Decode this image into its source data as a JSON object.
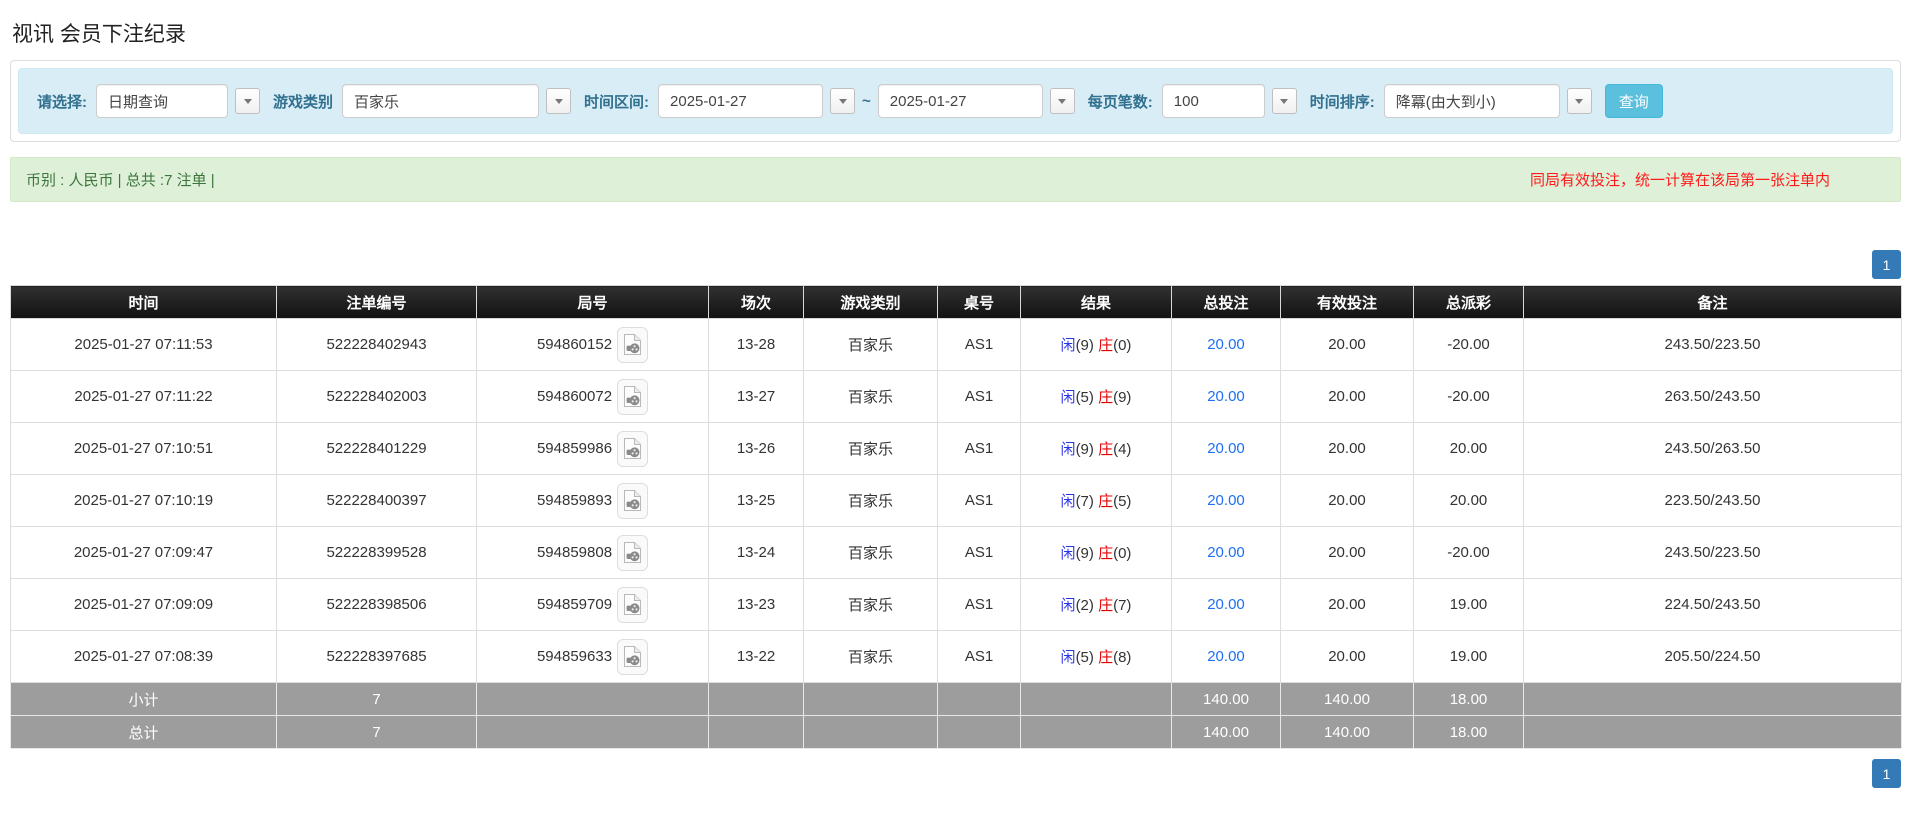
{
  "title": "视讯 会员下注纪录",
  "filters": {
    "query_type": {
      "label": "请选择:",
      "value": "日期查询"
    },
    "game_category": {
      "label": "游戏类别",
      "value": "百家乐"
    },
    "time_range": {
      "label": "时间区间:",
      "from": "2025-01-27",
      "separator": "~",
      "to": "2025-01-27"
    },
    "page_size": {
      "label": "每页笔数:",
      "value": "100"
    },
    "time_sort": {
      "label": "时间排序:",
      "value": "降冪(由大到小)"
    },
    "search_button": "查询"
  },
  "summary": {
    "left": "币别 : 人民币 | 总共 :7 注单 |",
    "notice": "同局有效投注，统一计算在该局第一张注单内"
  },
  "pagination": {
    "page": "1"
  },
  "icons": {
    "dropdown": "chevron-down-icon",
    "round_action": "video-file-icon"
  },
  "colors": {
    "filter_bar_bg": "#d9edf7",
    "filter_label": "#31708f",
    "search_button_bg": "#5bc0de",
    "summary_bg": "#dff0d8",
    "summary_text": "#3c763d",
    "notice_red": "#ff1a1a",
    "header_bg": "#1a1a1a",
    "sum_row_bg": "#9d9d9d",
    "pagination_active": "#337ab7",
    "bet_link": "#1f6ff0",
    "player_blue": "#2b35e8",
    "banker_red": "#e60000",
    "negative_red": "#ff0000"
  },
  "table": {
    "columns": [
      {
        "key": "time",
        "label": "时间"
      },
      {
        "key": "bet_no",
        "label": "注单编号"
      },
      {
        "key": "round_no",
        "label": "局号"
      },
      {
        "key": "session",
        "label": "场次"
      },
      {
        "key": "game",
        "label": "游戏类别"
      },
      {
        "key": "table_no",
        "label": "桌号"
      },
      {
        "key": "result",
        "label": "结果"
      },
      {
        "key": "total_bet",
        "label": "总投注"
      },
      {
        "key": "valid_bet",
        "label": "有效投注"
      },
      {
        "key": "payout",
        "label": "总派彩"
      },
      {
        "key": "remark",
        "label": "备注"
      }
    ],
    "rows": [
      {
        "time": "2025-01-27 07:11:53",
        "bet_no": "522228402943",
        "round_no": "594860152",
        "session": "13-28",
        "game": "百家乐",
        "table_no": "AS1",
        "player": "闲",
        "player_score": "(9)",
        "banker": "庄",
        "banker_score": "(0)",
        "total_bet": "20.00",
        "valid_bet": "20.00",
        "payout": "-20.00",
        "remark": "243.50/223.50"
      },
      {
        "time": "2025-01-27 07:11:22",
        "bet_no": "522228402003",
        "round_no": "594860072",
        "session": "13-27",
        "game": "百家乐",
        "table_no": "AS1",
        "player": "闲",
        "player_score": "(5)",
        "banker": "庄",
        "banker_score": "(9)",
        "total_bet": "20.00",
        "valid_bet": "20.00",
        "payout": "-20.00",
        "remark": "263.50/243.50"
      },
      {
        "time": "2025-01-27 07:10:51",
        "bet_no": "522228401229",
        "round_no": "594859986",
        "session": "13-26",
        "game": "百家乐",
        "table_no": "AS1",
        "player": "闲",
        "player_score": "(9)",
        "banker": "庄",
        "banker_score": "(4)",
        "total_bet": "20.00",
        "valid_bet": "20.00",
        "payout": "20.00",
        "remark": "243.50/263.50"
      },
      {
        "time": "2025-01-27 07:10:19",
        "bet_no": "522228400397",
        "round_no": "594859893",
        "session": "13-25",
        "game": "百家乐",
        "table_no": "AS1",
        "player": "闲",
        "player_score": "(7)",
        "banker": "庄",
        "banker_score": "(5)",
        "total_bet": "20.00",
        "valid_bet": "20.00",
        "payout": "20.00",
        "remark": "223.50/243.50"
      },
      {
        "time": "2025-01-27 07:09:47",
        "bet_no": "522228399528",
        "round_no": "594859808",
        "session": "13-24",
        "game": "百家乐",
        "table_no": "AS1",
        "player": "闲",
        "player_score": "(9)",
        "banker": "庄",
        "banker_score": "(0)",
        "total_bet": "20.00",
        "valid_bet": "20.00",
        "payout": "-20.00",
        "remark": "243.50/223.50"
      },
      {
        "time": "2025-01-27 07:09:09",
        "bet_no": "522228398506",
        "round_no": "594859709",
        "session": "13-23",
        "game": "百家乐",
        "table_no": "AS1",
        "player": "闲",
        "player_score": "(2)",
        "banker": "庄",
        "banker_score": "(7)",
        "total_bet": "20.00",
        "valid_bet": "20.00",
        "payout": "19.00",
        "remark": "224.50/243.50"
      },
      {
        "time": "2025-01-27 07:08:39",
        "bet_no": "522228397685",
        "round_no": "594859633",
        "session": "13-22",
        "game": "百家乐",
        "table_no": "AS1",
        "player": "闲",
        "player_score": "(5)",
        "banker": "庄",
        "banker_score": "(8)",
        "total_bet": "20.00",
        "valid_bet": "20.00",
        "payout": "19.00",
        "remark": "205.50/224.50"
      }
    ],
    "footer_rows": [
      {
        "label": "小计",
        "count": "7",
        "total_bet": "140.00",
        "valid_bet": "140.00",
        "payout": "18.00"
      },
      {
        "label": "总计",
        "count": "7",
        "total_bet": "140.00",
        "valid_bet": "140.00",
        "payout": "18.00"
      }
    ]
  }
}
